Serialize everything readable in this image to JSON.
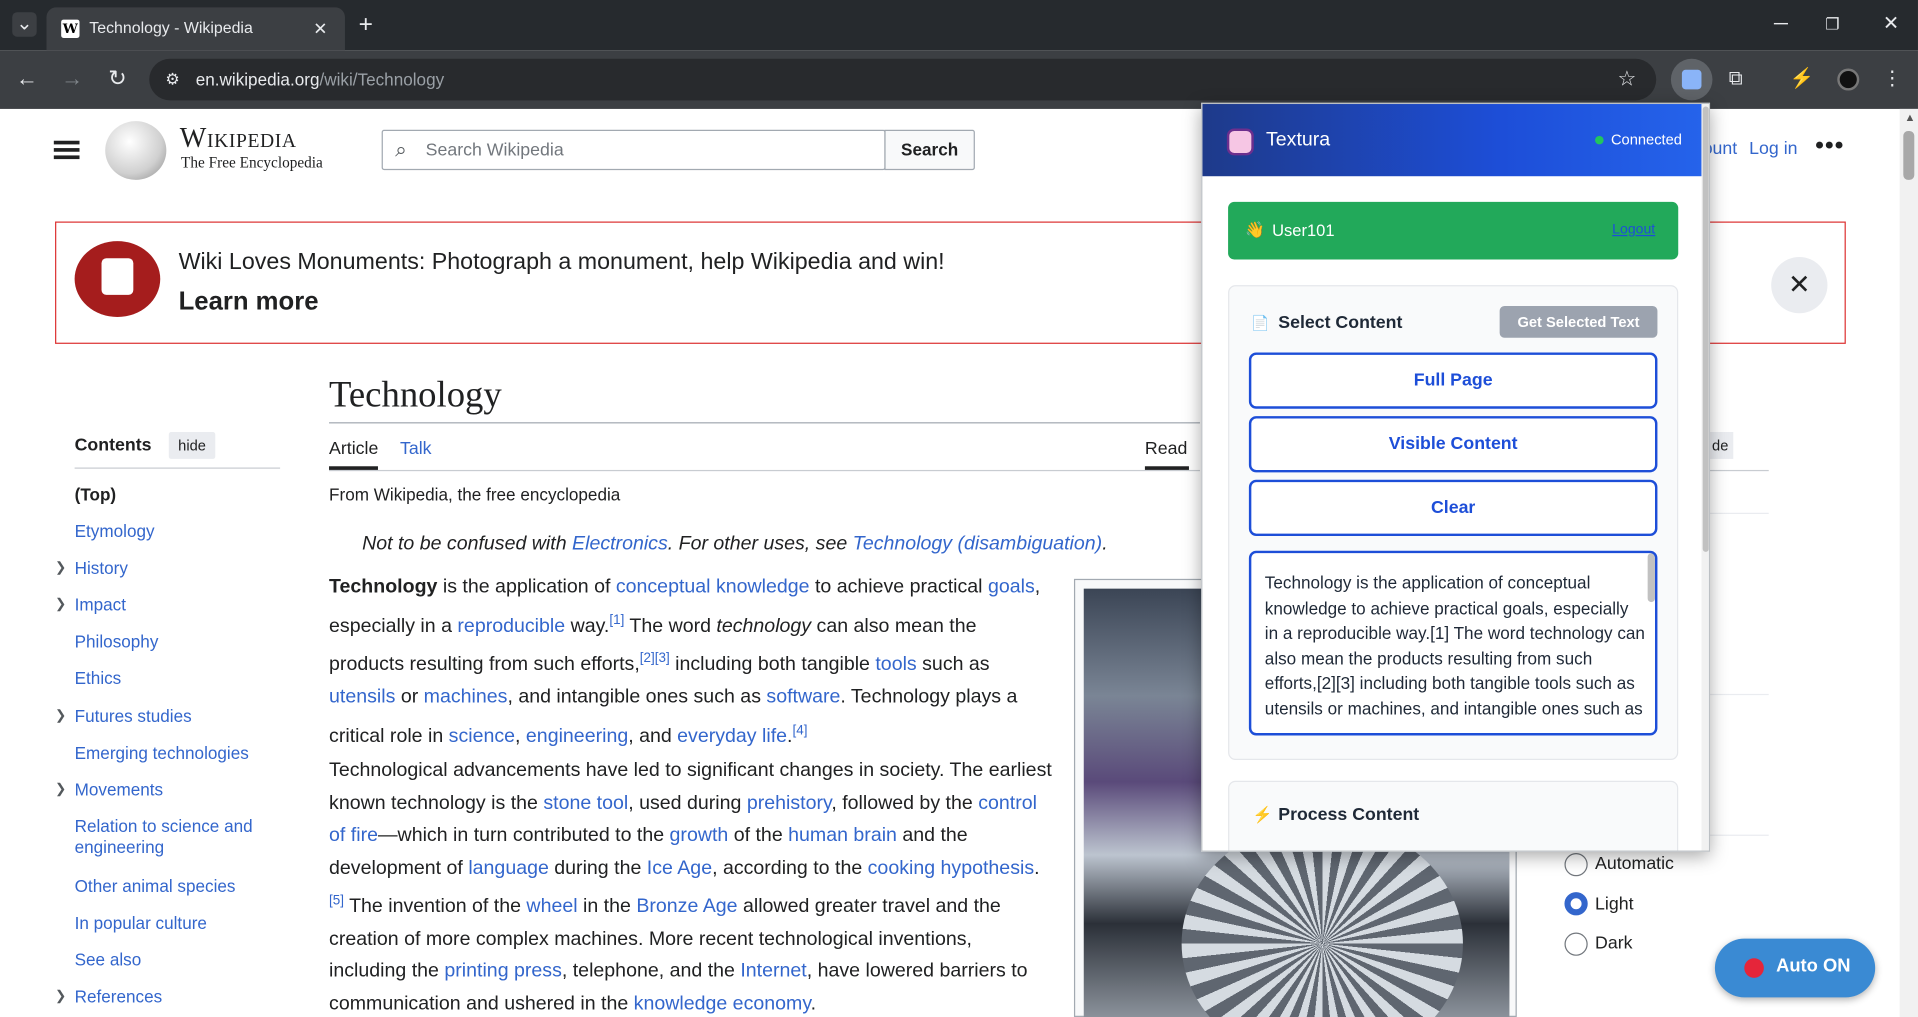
{
  "browser": {
    "tab_title": "Technology - Wikipedia",
    "url_domain": "en.wikipedia.org",
    "url_path": "/wiki/Technology"
  },
  "wiki": {
    "logo_title": "Wikipedia",
    "logo_tagline": "The Free Encyclopedia",
    "search_placeholder": "Search Wikipedia",
    "search_button": "Search",
    "account_text": "ount",
    "login": "Log in",
    "banner_text": "Wiki Loves Monuments: Photograph a monument, help Wikipedia and win!",
    "banner_link": "Learn more",
    "page_title": "Technology",
    "tabs": {
      "article": "Article",
      "talk": "Talk",
      "read": "Read"
    },
    "tagline": "From Wikipedia, the free encyclopedia",
    "hatnote": {
      "pre": "Not to be confused with ",
      "link1": "Electronics",
      "mid": ". For other uses, see ",
      "link2": "Technology (disambiguation)",
      "post": "."
    },
    "toc": {
      "heading": "Contents",
      "hide": "hide",
      "items": [
        "(Top)",
        "Etymology",
        "History",
        "Impact",
        "Philosophy",
        "Ethics",
        "Futures studies",
        "Emerging technologies",
        "Movements",
        "Relation to science and engineering",
        "Other animal species",
        "In popular culture",
        "See also",
        "References"
      ]
    },
    "right_hide": "de",
    "appearance": {
      "options": [
        "Automatic",
        "Light",
        "Dark"
      ],
      "selected": "Light"
    }
  },
  "popup": {
    "app_name": "Textura",
    "status": "Connected",
    "user": "User101",
    "logout": "Logout",
    "select_heading": "Select Content",
    "get_selected": "Get Selected Text",
    "btn_full": "Full Page",
    "btn_visible": "Visible Content",
    "btn_clear": "Clear",
    "textarea": "Technology is the application of conceptual knowledge to achieve practical goals, especially in a reproducible way.[1] The word technology can also mean the products resulting from such efforts,[2][3] including both tangible tools such as utensils or machines, and intangible ones such as",
    "process_heading": "Process Content"
  },
  "auto_button": "Auto ON",
  "colors": {
    "wiki_link": "#3366cc",
    "popup_blue": "#1d4ed8",
    "user_green": "#22a95a",
    "banner_border": "#dd3333"
  }
}
